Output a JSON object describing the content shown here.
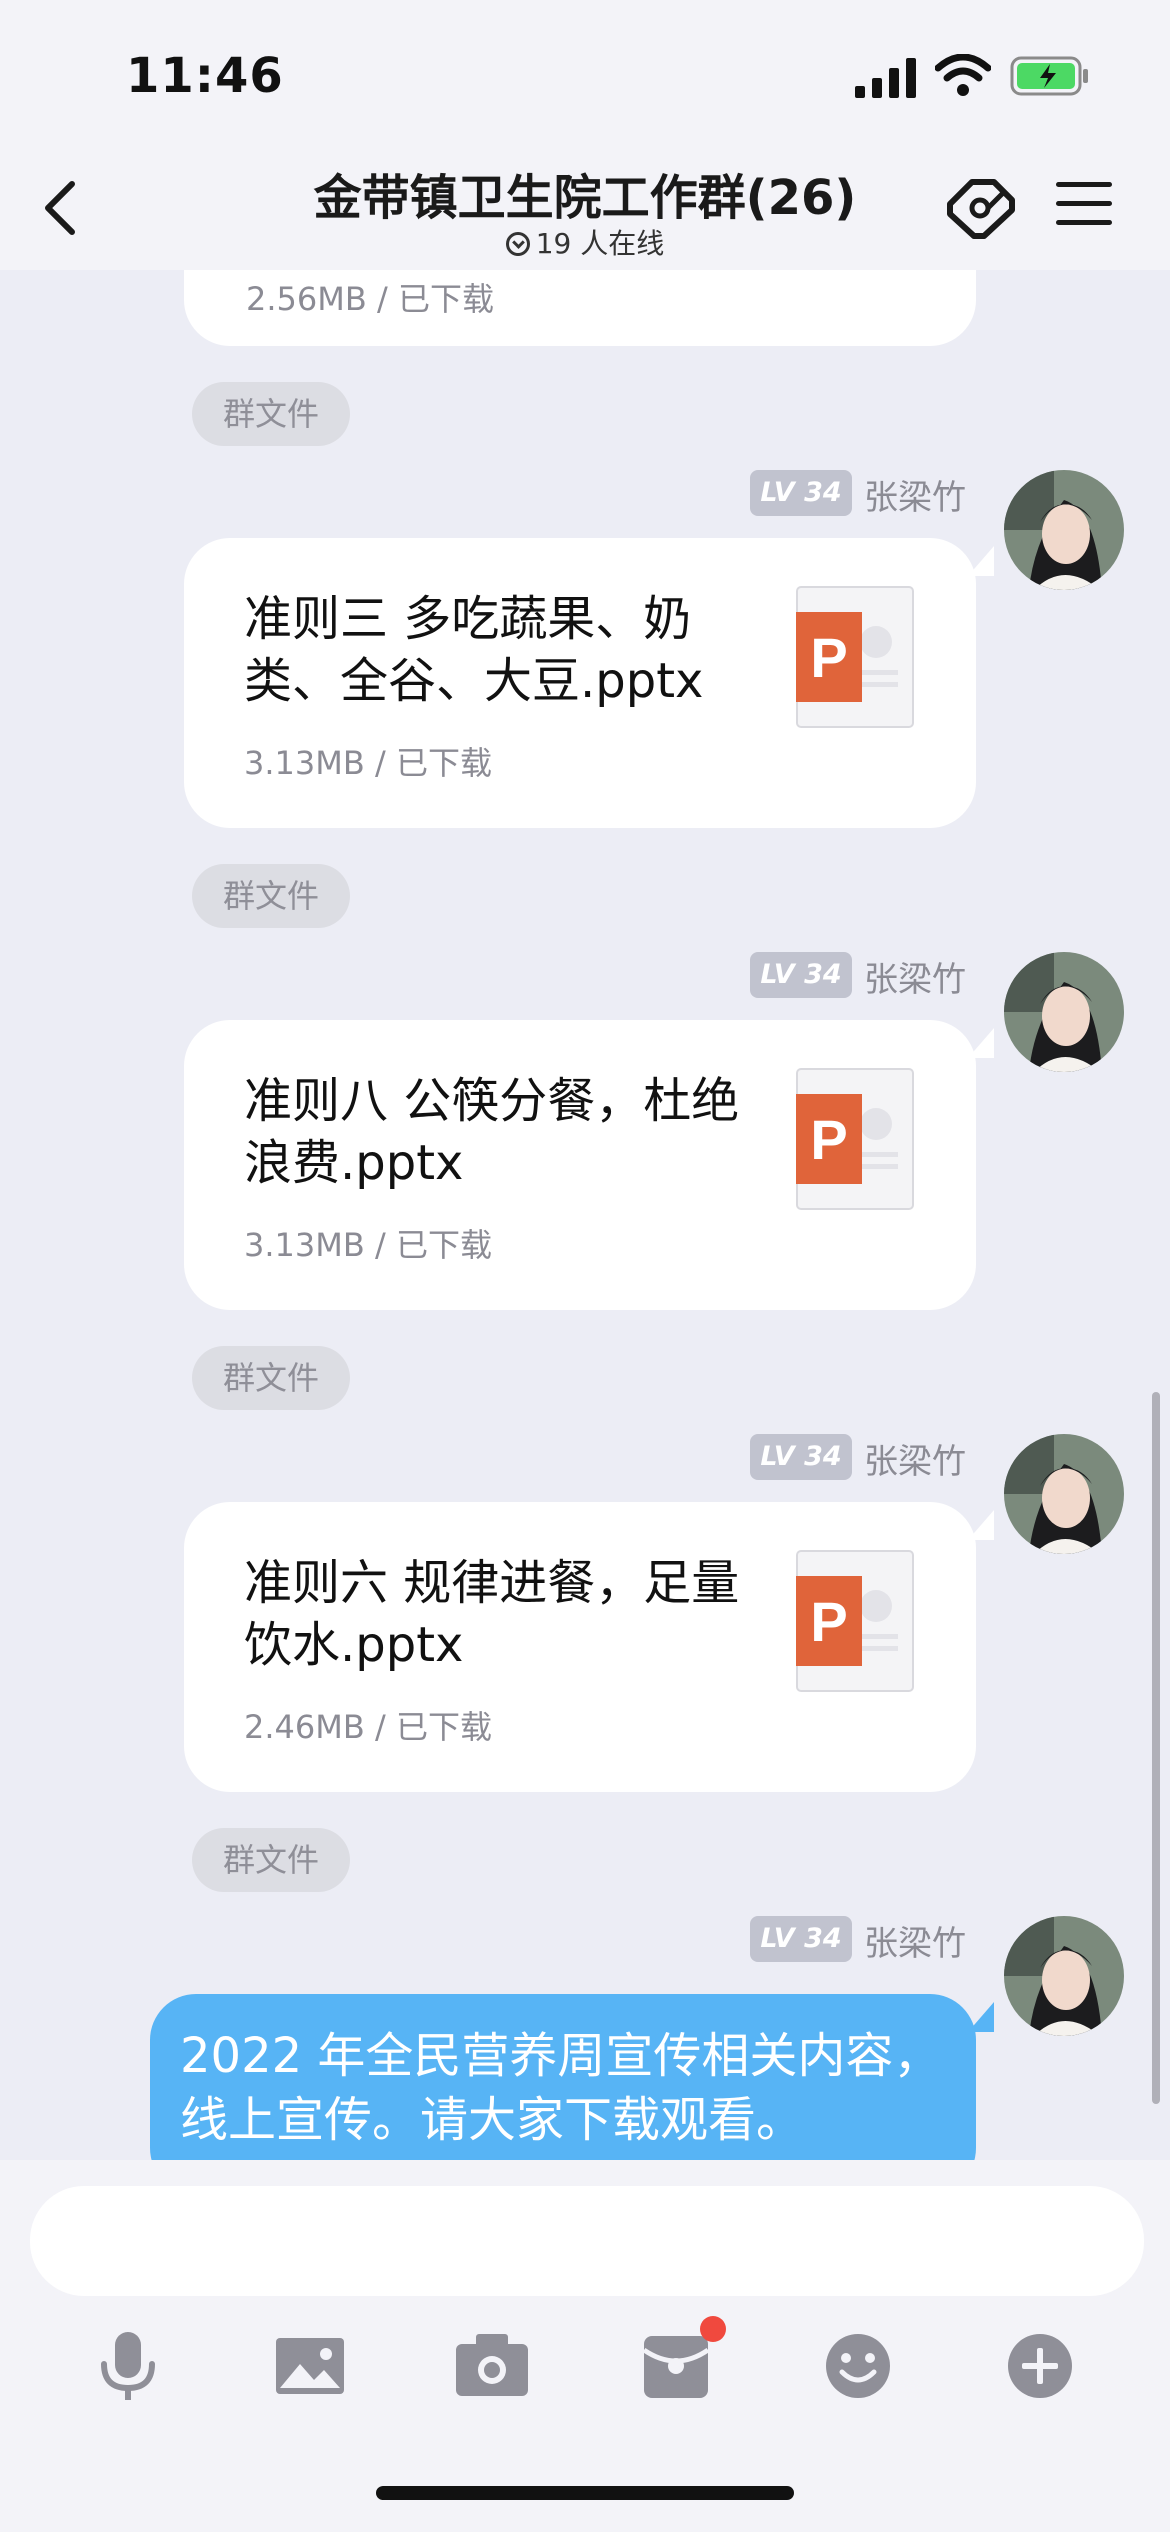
{
  "status_bar": {
    "time": "11:46"
  },
  "header": {
    "title": "金带镇卫生院工作群(26)",
    "online": "19 人在线"
  },
  "partial_top": {
    "meta": "2.56MB / 已下载"
  },
  "messages": [
    {
      "system_tag": "群文件",
      "level": "LV 34",
      "sender": "张梁竹",
      "file_title": "准则三 多吃蔬果、奶类、全谷、大豆.pptx",
      "file_meta": "3.13MB / 已下载"
    },
    {
      "system_tag": "群文件",
      "level": "LV 34",
      "sender": "张梁竹",
      "file_title": "准则八 公筷分餐，杜绝浪费.pptx",
      "file_meta": "3.13MB / 已下载"
    },
    {
      "system_tag": "群文件",
      "level": "LV 34",
      "sender": "张梁竹",
      "file_title": "准则六 规律进餐，足量饮水.pptx",
      "file_meta": "2.46MB / 已下载"
    },
    {
      "system_tag": "群文件",
      "level": "LV 34",
      "sender": "张梁竹",
      "text": "2022 年全民营养周宣传相关内容，线上宣传。请大家下载观看。"
    }
  ],
  "input": {
    "placeholder": ""
  },
  "toolbar": [
    "microphone-icon",
    "image-icon",
    "camera-icon",
    "red-packet-icon",
    "emoji-icon",
    "plus-icon"
  ],
  "colors": {
    "accent_blue": "#57b4f5",
    "ppt_orange": "#e0643a",
    "badge_red": "#f0493e"
  }
}
